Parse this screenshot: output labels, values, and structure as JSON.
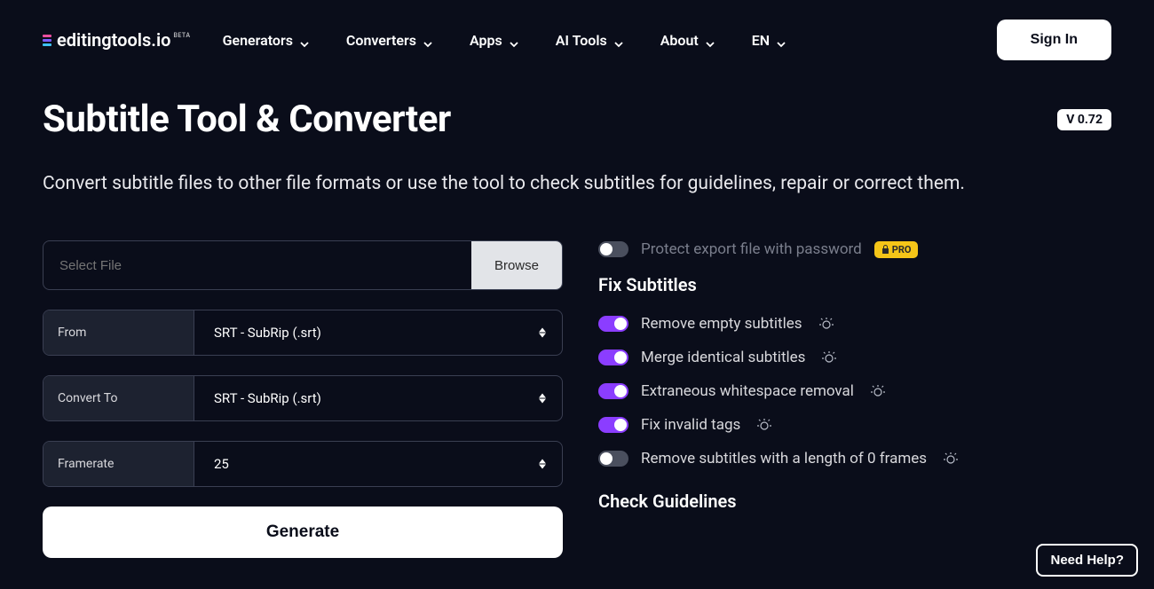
{
  "header": {
    "logo_text": "editingtools.io",
    "logo_badge": "BETA",
    "nav": [
      "Generators",
      "Converters",
      "Apps",
      "AI Tools",
      "About",
      "EN"
    ],
    "signin": "Sign In"
  },
  "page": {
    "title": "Subtitle Tool & Converter",
    "version": "V 0.72",
    "subtitle": "Convert subtitle files to other file formats or use the tool to check subtitles for guidelines, repair or correct them."
  },
  "form": {
    "file_placeholder": "Select File",
    "browse": "Browse",
    "fields": [
      {
        "label": "From",
        "value": "SRT - SubRip (.srt)"
      },
      {
        "label": "Convert To",
        "value": "SRT - SubRip (.srt)"
      },
      {
        "label": "Framerate",
        "value": "25"
      }
    ],
    "generate": "Generate"
  },
  "options": {
    "protect": {
      "label": "Protect export file with password",
      "on": false,
      "pro": "PRO"
    },
    "fix_title": "Fix Subtitles",
    "fix": [
      {
        "label": "Remove empty subtitles",
        "on": true
      },
      {
        "label": "Merge identical subtitles",
        "on": true
      },
      {
        "label": "Extraneous whitespace removal",
        "on": true
      },
      {
        "label": "Fix invalid tags",
        "on": true
      },
      {
        "label": "Remove subtitles with a length of 0 frames",
        "on": false
      }
    ],
    "check_title": "Check Guidelines"
  },
  "help": "Need Help?"
}
